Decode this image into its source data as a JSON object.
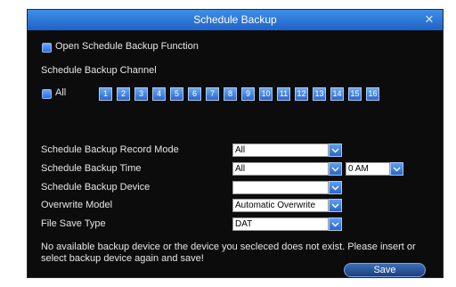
{
  "dialog": {
    "title": "Schedule Backup"
  },
  "open_function": {
    "label": "Open Schedule Backup Function"
  },
  "channel": {
    "section_label": "Schedule Backup Channel",
    "all_label": "All",
    "channels": [
      "1",
      "2",
      "3",
      "4",
      "5",
      "6",
      "7",
      "8",
      "9",
      "10",
      "11",
      "12",
      "13",
      "14",
      "15",
      "16"
    ]
  },
  "fields": {
    "record_mode": {
      "label": "Schedule Backup Record Mode",
      "value": "All"
    },
    "time": {
      "label": "Schedule Backup Time",
      "value": "All",
      "hour_value": "0 AM"
    },
    "device": {
      "label": "Schedule Backup Device",
      "value": ""
    },
    "overwrite": {
      "label": "Overwrite Model",
      "value": "Automatic Overwrite"
    },
    "file_type": {
      "label": "File Save Type",
      "value": "DAT"
    }
  },
  "message": {
    "line1": "No available backup device or the device you secleced does not exist. Please insert or",
    "line2": "select backup device again and save!"
  },
  "buttons": {
    "save": "Save"
  },
  "colors": {
    "title_bar": "#2f7be0",
    "background": "#0c0c0c",
    "accent": "#3b7fe0"
  }
}
